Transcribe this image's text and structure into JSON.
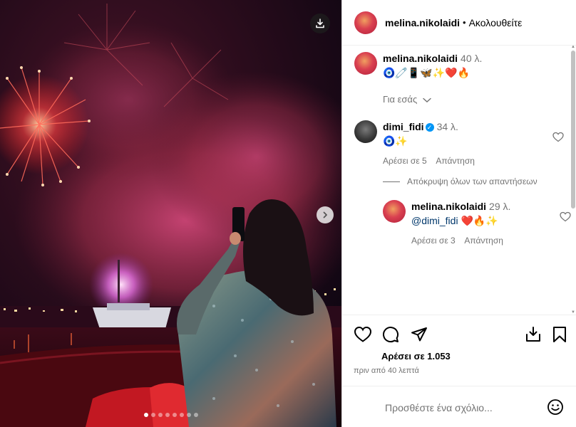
{
  "post": {
    "username": "melina.nikolaidi",
    "separator": "•",
    "follow_status": "Ακολουθείτε",
    "carousel": {
      "slide_count": 8,
      "active_index": 0
    }
  },
  "caption": {
    "username": "melina.nikolaidi",
    "time": "40 λ.",
    "text": "🧿🧷📱🦋✨❤️🔥",
    "see_translation": "Για εσάς"
  },
  "comments": [
    {
      "username": "dimi_fidi",
      "verified": true,
      "time": "34 λ.",
      "text": "🧿✨",
      "likes": "Αρέσει σε 5",
      "reply": "Απάντηση"
    }
  ],
  "hide_replies": "Απόκρυψη όλων των απαντήσεων",
  "replies": [
    {
      "username": "melina.nikolaidi",
      "time": "29 λ.",
      "mention": "@dimi_fidi",
      "text": " ❤️🔥✨",
      "likes": "Αρέσει σε 3",
      "reply": "Απάντηση"
    }
  ],
  "engagement": {
    "likes": "Αρέσει σε 1.053",
    "time_ago": "πριν από 40 λεπτά"
  },
  "add_comment": {
    "placeholder": "Προσθέστε ένα σχόλιο..."
  },
  "colors": {
    "link": "#00376b",
    "secondary_text": "#737373",
    "verified": "#0095f6"
  }
}
